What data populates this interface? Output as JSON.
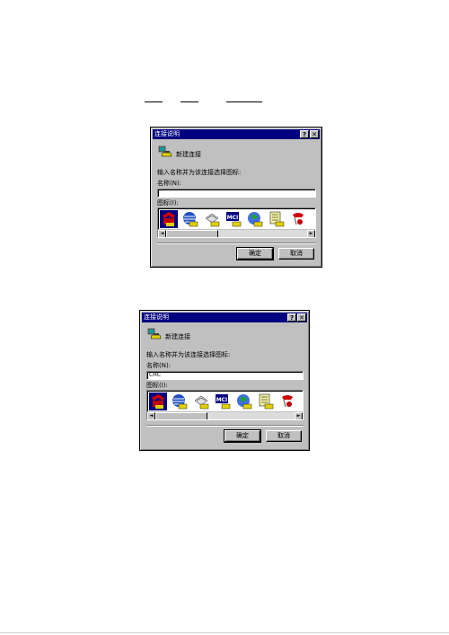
{
  "dialogs": [
    {
      "title": "连接说明",
      "help_button": "?",
      "close_button": "✕",
      "header_label": "新建连接",
      "prompt": "输入名称并为该连接选择图标:",
      "name_label": "名称(N):",
      "name_value": "",
      "icon_label": "图标(I):",
      "scroll_left": "◄",
      "scroll_right": "►",
      "ok_label": "确定",
      "cancel_label": "取消"
    },
    {
      "title": "连接说明",
      "help_button": "?",
      "close_button": "✕",
      "header_label": "新建连接",
      "prompt": "输入名称并为该连接选择图标:",
      "name_label": "名称(N):",
      "name_value": "CHC",
      "icon_label": "图标(I):",
      "scroll_left": "◄",
      "scroll_right": "►",
      "ok_label": "确定",
      "cancel_label": "取消"
    }
  ],
  "icons": [
    "phone-red-icon",
    "globe-icon",
    "fax-icon",
    "mci-icon",
    "globe-blue-icon",
    "notepad-icon",
    "phone-red2-icon"
  ],
  "mci_text": "MCI",
  "colors": {
    "titlebar": "#000080",
    "face": "#c0c0c0",
    "selection": "#000080"
  }
}
